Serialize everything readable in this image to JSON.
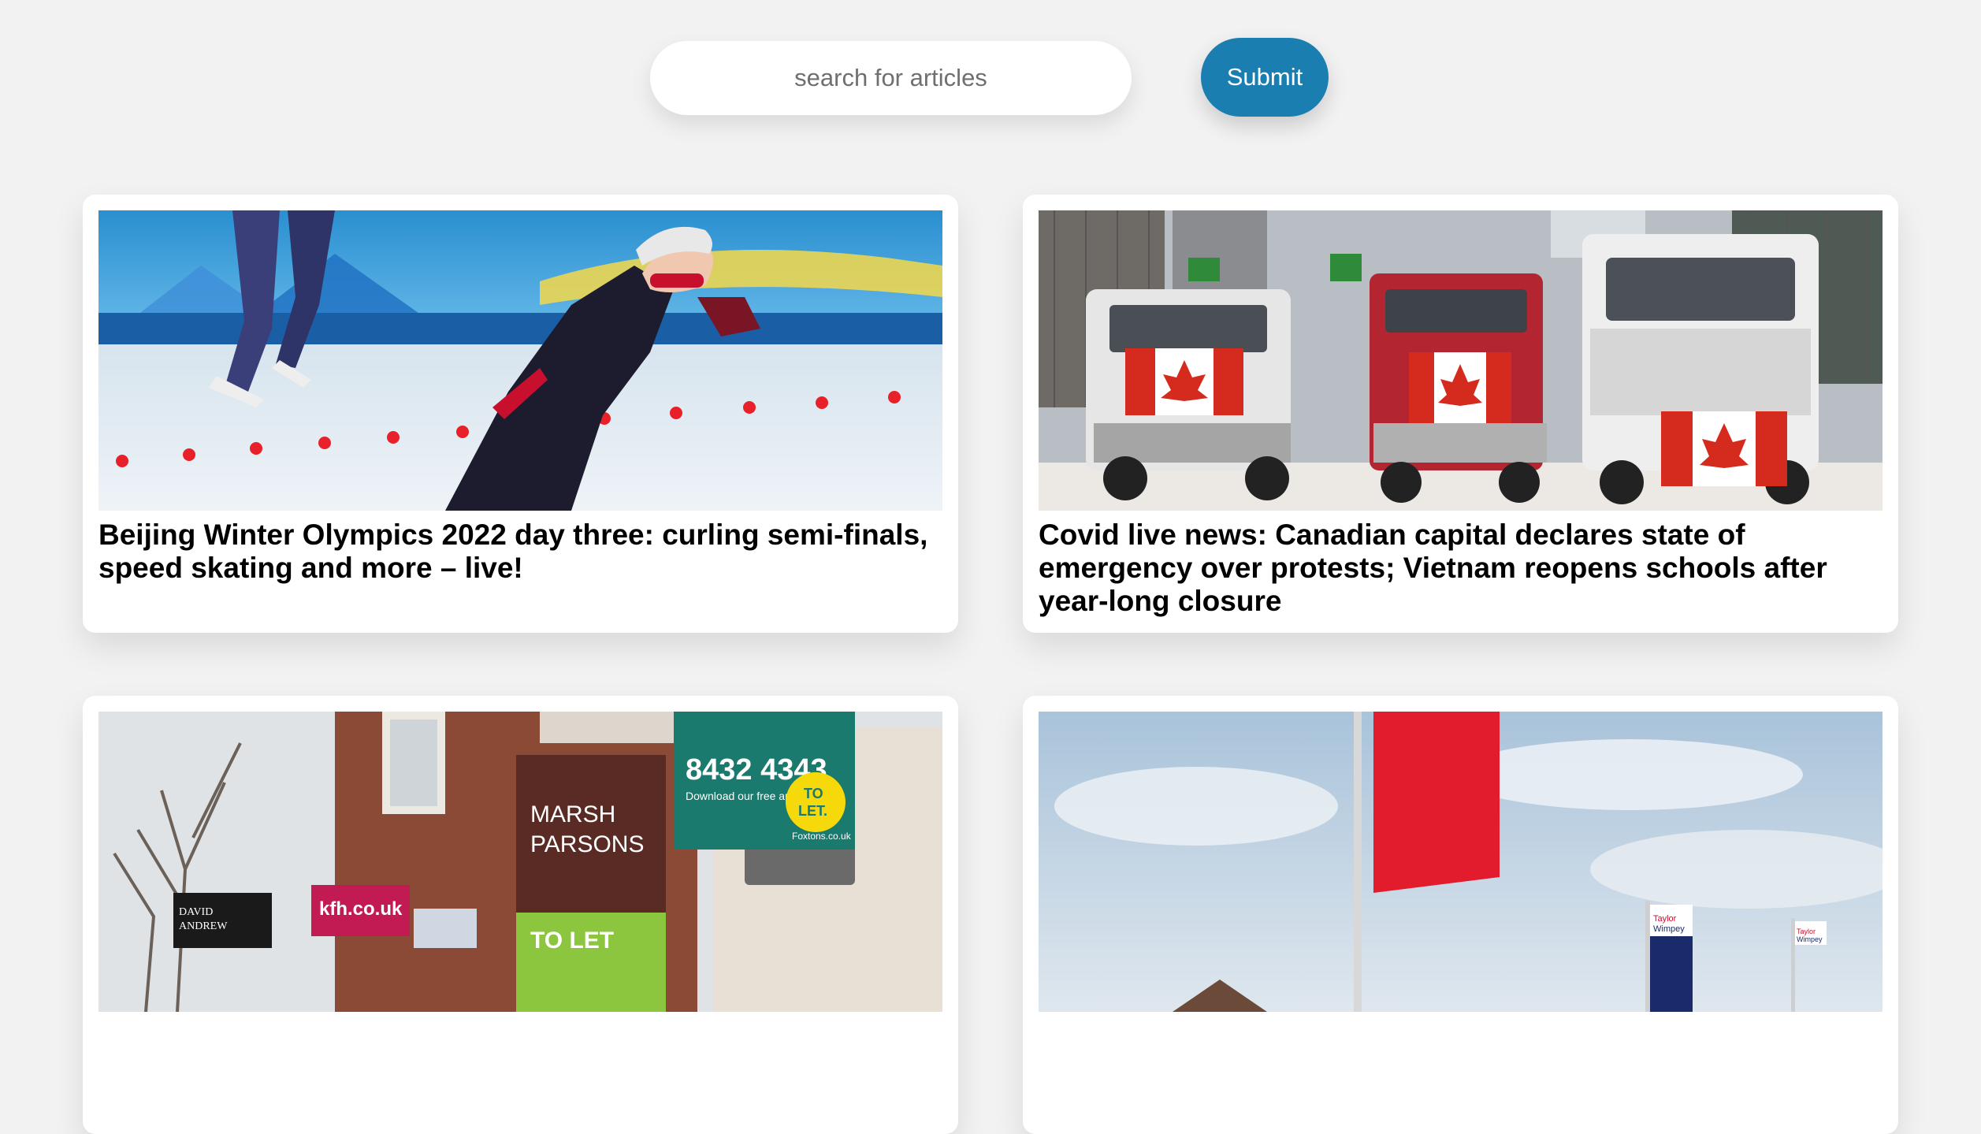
{
  "search": {
    "placeholder": "search for articles",
    "value": "",
    "submit_label": "Submit"
  },
  "colors": {
    "page_background": "#f2f2f2",
    "submit_button": "#1a7fb0",
    "card_background": "#ffffff"
  },
  "articles": [
    {
      "title": "Beijing Winter Olympics 2022 day three: curling semi-finals, speed skating and more – live!",
      "image_subject": "speed-skater-photo"
    },
    {
      "title": "Covid live news: Canadian capital declares state of emergency over protests; Vietnam reopens schools after year-long closure",
      "image_subject": "trucks-with-canadian-flags-photo",
      "image_text": [
        "Canadian flags on trucks"
      ]
    },
    {
      "title": "",
      "image_subject": "estate-agent-to-let-signs-photo",
      "image_text": [
        "8432 4343",
        "Download our free app",
        "TO LET",
        "MARSH & PARSONS",
        "TO LET",
        "kfh.co.uk",
        "DAVID ANDREW",
        "Foxtons.co.uk"
      ]
    },
    {
      "title": "",
      "image_subject": "red-flag-housing-development-photo",
      "image_text": [
        "Taylor Wimpey",
        "Taylor Wimpey"
      ]
    }
  ]
}
